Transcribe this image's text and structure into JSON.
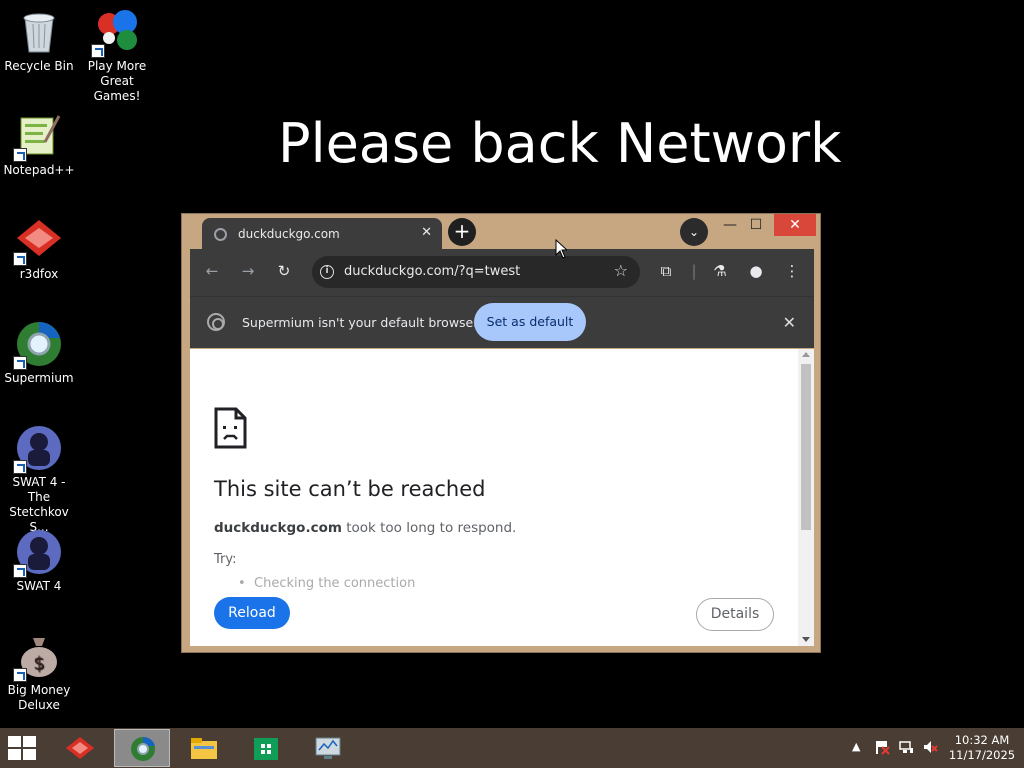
{
  "desktop": {
    "wallpaper_text": "Please back Network",
    "icons": [
      {
        "label": "Recycle Bin"
      },
      {
        "label": "Play More Great Games!"
      },
      {
        "label": "Notepad++"
      },
      {
        "label": "r3dfox"
      },
      {
        "label": "Supermium"
      },
      {
        "label": "SWAT 4 - The Stetchkov S..."
      },
      {
        "label": "SWAT 4"
      },
      {
        "label": "Big Money Deluxe"
      }
    ]
  },
  "browser": {
    "tab_title": "duckduckgo.com",
    "tab_close": "✕",
    "new_tab": "+",
    "url": "duckduckgo.com/?q=twest",
    "infobar": {
      "message": "Supermium isn't your default browser",
      "set_default_label": "Set as default",
      "close": "✕"
    },
    "error": {
      "title": "This site can’t be reached",
      "domain": "duckduckgo.com",
      "desc_rest": " took too long to respond.",
      "try_label": "Try:",
      "suggestion": "Checking the connection",
      "reload_label": "Reload",
      "details_label": "Details"
    }
  },
  "taskbar": {
    "time": "10:32 AM",
    "date": "11/17/2025"
  },
  "colors": {
    "window_frame": "#c7a782",
    "close_button": "#d9473a",
    "set_default_bg": "#a8c7fa",
    "reload_bg": "#1a73e8",
    "taskbar_bg": "#4a3d33"
  }
}
